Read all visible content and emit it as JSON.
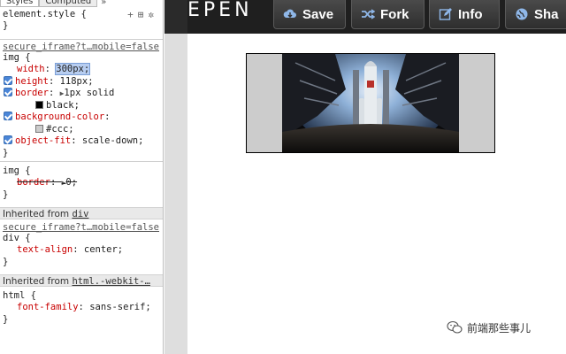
{
  "devtools": {
    "tabs": {
      "styles": "Styles",
      "computed": "Computed",
      "more": "»"
    },
    "element_style": {
      "selector": "element.style {",
      "close": "}",
      "icons": [
        "plus-icon",
        "toggle-state-icon",
        "gear-icon"
      ]
    },
    "rule1": {
      "source": "secure_iframe?t…mobile=false",
      "selector": "img {",
      "decls": [
        {
          "name": "width",
          "value": "300px;"
        },
        {
          "name": "height",
          "value": "118px;"
        },
        {
          "name": "border",
          "value": "1px solid"
        },
        {
          "name": "",
          "value": "black;"
        },
        {
          "name": "background-color",
          "value": ""
        },
        {
          "name": "",
          "value": "#ccc;"
        },
        {
          "name": "object-fit",
          "value": "scale-down;"
        }
      ],
      "close": "}",
      "colors": {
        "black": "#000000",
        "ccc": "#cccccc"
      }
    },
    "rule2": {
      "selector": "img {",
      "decl_name": "border",
      "decl_value": "0;",
      "close": "}"
    },
    "inherited1": {
      "prefix": "Inherited from ",
      "link": "div"
    },
    "rule3": {
      "source": "secure_iframe?t…mobile=false",
      "selector": "div {",
      "decl_name": "text-align",
      "decl_value": "center;",
      "close": "}"
    },
    "inherited2": {
      "prefix": "Inherited from ",
      "link": "html.-webkit-…"
    },
    "rule4": {
      "selector": "html {",
      "decl_name": "font-family",
      "decl_value": "sans-serif;",
      "close": "}"
    }
  },
  "codepen": {
    "logo": "EPEN",
    "buttons": [
      {
        "label": "Save",
        "icon": "cloud-save-icon"
      },
      {
        "label": "Fork",
        "icon": "fork-icon"
      },
      {
        "label": "Info",
        "icon": "edit-icon"
      },
      {
        "label": "Sha",
        "icon": "globe-icon"
      }
    ]
  },
  "watermark": {
    "text": "前端那些事儿",
    "icon": "wechat-icon"
  },
  "colors": {
    "header_bg": "#1f1f1f",
    "img_bg": "#cccccc",
    "prop_name": "#c80000",
    "checkbox": "#4a86d8"
  }
}
